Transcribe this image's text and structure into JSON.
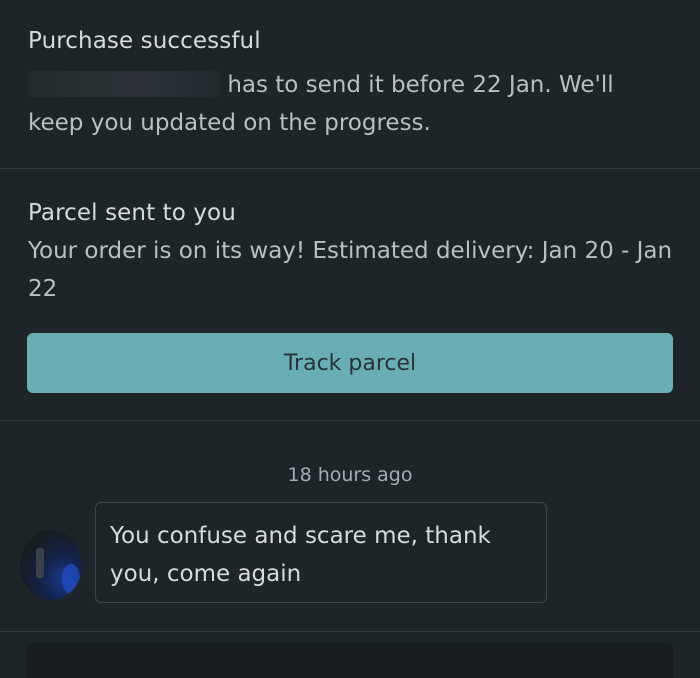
{
  "purchase": {
    "title": "Purchase successful",
    "line1_suffix": "has to send it before 22 Jan. We'll",
    "line2": "keep you updated on the progress."
  },
  "parcel": {
    "title": "Parcel sent to you",
    "message": "Your order is on its way! Estimated delivery: Jan 20 - Jan 22",
    "track_label": "Track parcel"
  },
  "chat": {
    "timestamp": "18 hours ago",
    "message": "You confuse and scare me, thank you, come again"
  }
}
